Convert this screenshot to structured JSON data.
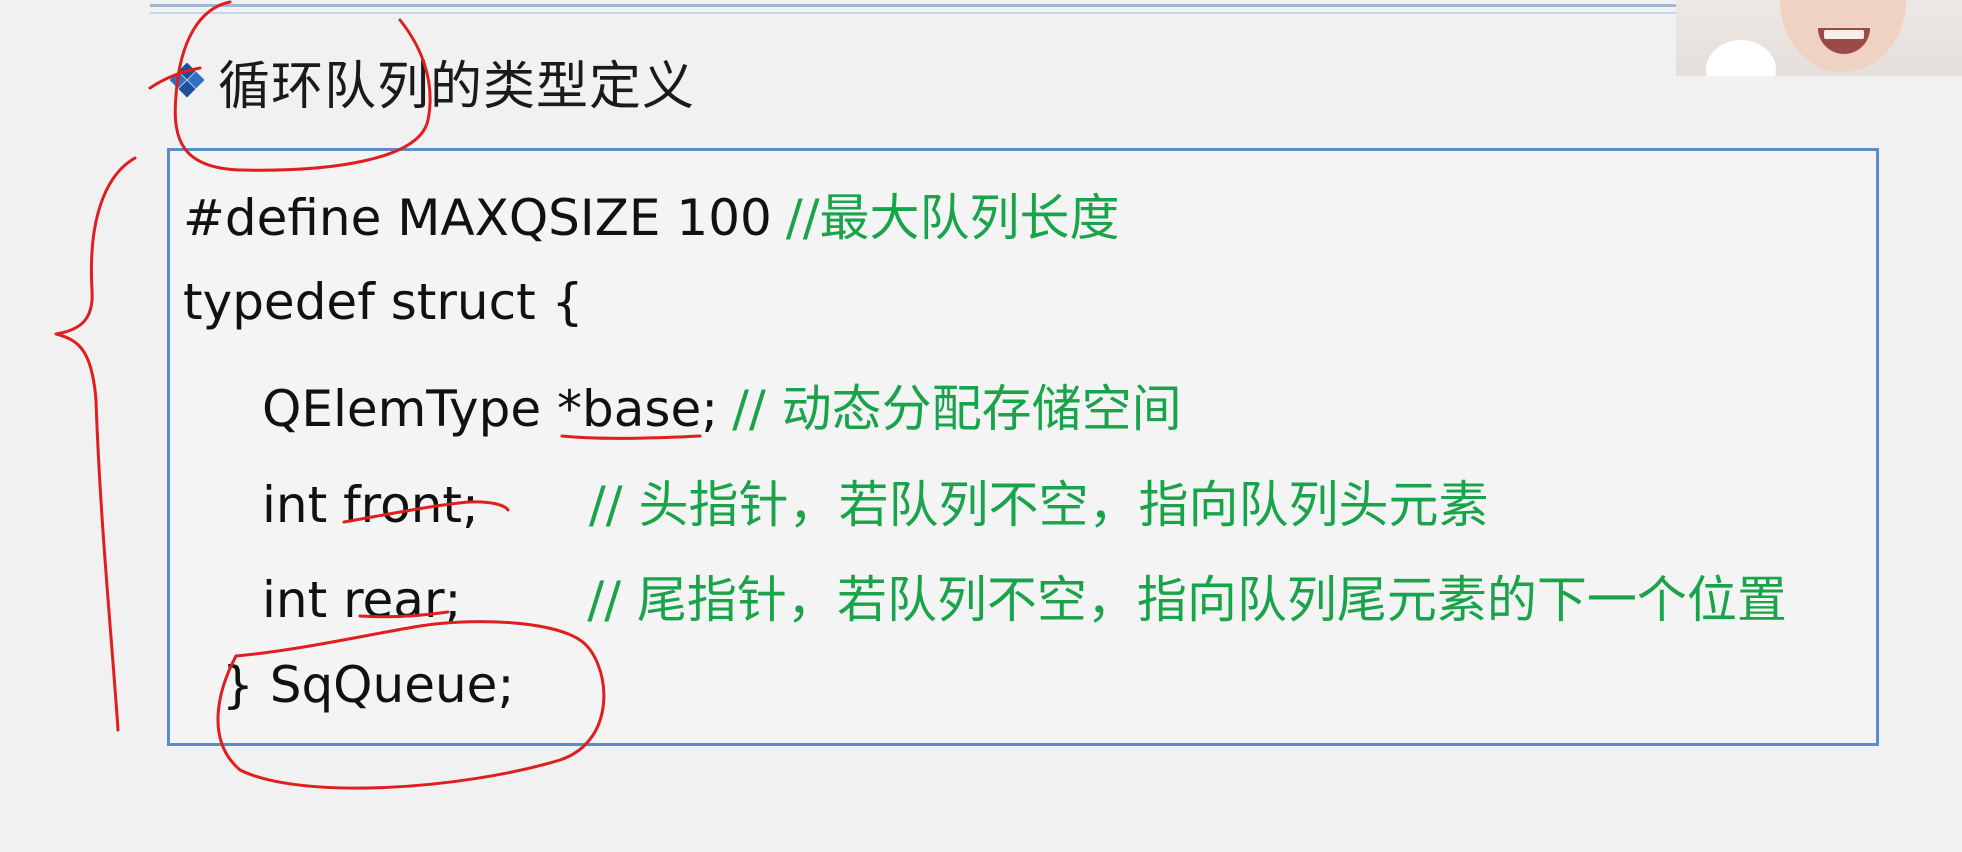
{
  "slide": {
    "heading": "循环队列的类型定义",
    "bullet_icon": "diamond-bullet-icon",
    "code_lines": [
      {
        "code": "#define MAXQSIZE 100",
        "comment": "//最大队列长度"
      },
      {
        "code": "typedef struct {",
        "comment": ""
      },
      {
        "code": "QElemType *base;",
        "comment": "// 动态分配存储空间"
      },
      {
        "code": "int front;",
        "comment": "// 头指针，若队列不空，指向队列头元素"
      },
      {
        "code": "int rear;",
        "comment": "// 尾指针，若队列不空，指向队列尾元素的下一个位置"
      },
      {
        "code": "} SqQueue;",
        "comment": ""
      }
    ]
  },
  "colors": {
    "code_text": "#111111",
    "comment_text": "#19a34a",
    "box_border": "#5b8ccc",
    "annotation_ink": "#e01e1e"
  }
}
